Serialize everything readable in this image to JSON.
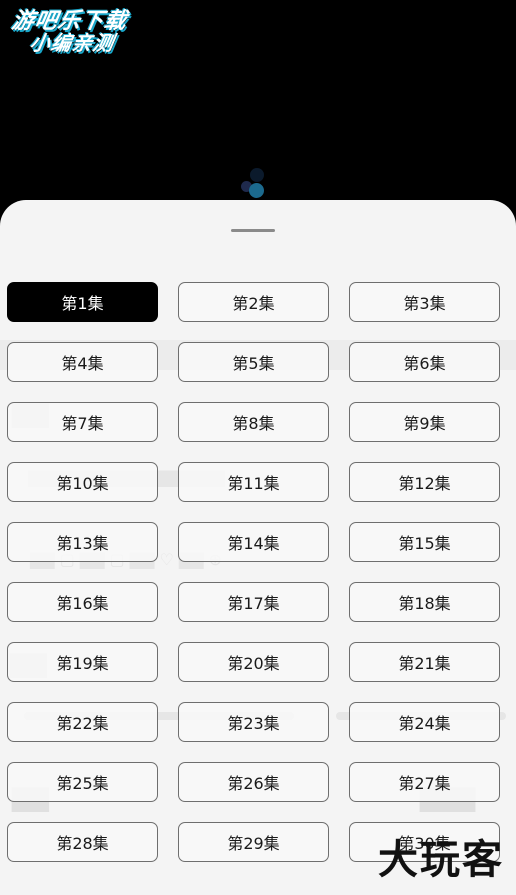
{
  "watermark_top": {
    "line1": "游吧乐下载",
    "line2": "小编亲测"
  },
  "watermark_bottom": {
    "text": "大玩客"
  },
  "player": {
    "state": "loading"
  },
  "episode_picker": {
    "selected_index": 0,
    "episodes": [
      "第1集",
      "第2集",
      "第3集",
      "第4集",
      "第5集",
      "第6集",
      "第7集",
      "第8集",
      "第9集",
      "第10集",
      "第11集",
      "第12集",
      "第13集",
      "第14集",
      "第15集",
      "第16集",
      "第17集",
      "第18集",
      "第19集",
      "第20集",
      "第21集",
      "第22集",
      "第23集",
      "第24集",
      "第25集",
      "第26集",
      "第27集",
      "第28集",
      "第29集",
      "第30集"
    ]
  },
  "colors": {
    "selected_bg": "#000000",
    "selected_text": "#ffffff",
    "button_border": "#6e6e6e",
    "sheet_bg": "#f4f4f4",
    "watermark_outline": "#19a6c9"
  }
}
